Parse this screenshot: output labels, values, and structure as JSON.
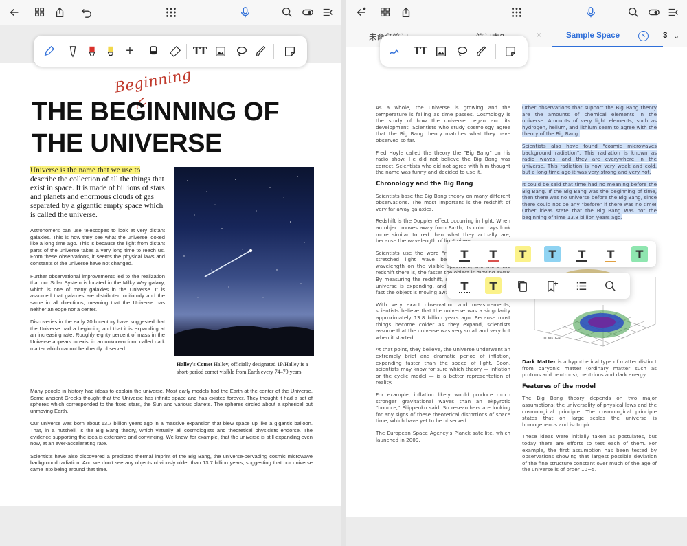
{
  "left": {
    "toolbar": {
      "icons": [
        "back-arrow-icon",
        "grid-view-icon",
        "export-icon",
        "undo-icon",
        "apps-icon",
        "microphone-icon",
        "search-icon",
        "toggle-icon",
        "menu-collapse-icon"
      ]
    },
    "pen_toolbar": {
      "tools": [
        "pen-icon",
        "fountain-pen-icon",
        "red-marker-icon",
        "yellow-highlighter-icon",
        "add-icon",
        "eraser-icon",
        "ruler-icon",
        "text-tool-icon",
        "image-icon",
        "lasso-icon",
        "brush-icon",
        "sticky-note-icon"
      ],
      "plus": "+",
      "text_tool": "TT"
    },
    "document": {
      "handwriting": "Beginning",
      "title_line1": "THE BEGINNING OF",
      "title_line2": "THE UNIVERSE",
      "lead_highlight": "Universe is the name that we use to",
      "lead_rest": "describe the collection of all the things that exist in space. It is made of billions of stars and planets and enormous clouds of gas separated by a gigantic empty space which is called the universe.",
      "col_left": [
        "Astronomers can use telescopes to look at very distant galaxies. This is how they see what the universe looked like a long time ago. This is because the light from distant parts of the universe takes a very long time to reach us. From these observations, it seems the physical laws and constants of the universe have not changed.",
        "Further observational improvements led to the realization that our Solar System is located in the Milky Way galaxy, which is one of many galaxies in the Universe. It is assumed that galaxies are distributed uniformly and the same in all directions, meaning that the Universe has neither an edge nor a center.",
        "Discoveries in the early 20th century have suggested that the Universe had a beginning and that it is expanding at an increasing rate. Roughly eighty percent of mass in the Universe appears to exist in an unknown form called dark matter which cannot be directly observed."
      ],
      "caption_bold": "Halley's Comet",
      "caption_text": "Halley, officially designated 1P/Halley is a short-period comet visible from Earth every 74–79 years.",
      "full_width": [
        "Many people in history had ideas to explain the universe. Most early models had the Earth at the center of the Universe. Some ancient Greeks thought that the Universe has infinite space and has existed forever. They thought it had a set of spheres which corresponded to the fixed stars, the Sun and various planets. The spheres circled about a spherical but unmoving Earth.",
        "Our universe was born about 13.7 billion years ago in a massive expansion that blew space up like a gigantic balloon. That, in a nutshell, is the Big Bang theory, which virtually all cosmologists and theoretical physicists endorse. The evidence supporting the idea is extensive and convincing. We know, for example, that the universe is still expanding even now, at an ever-accelerating rate.",
        "Scientists have also discovered a predicted thermal imprint of the Big Bang, the universe-pervading cosmic microwave background radiation. And we don't see any objects obviously older than 13.7 billion years, suggesting that our universe came into being around that time."
      ]
    }
  },
  "right": {
    "toolbar": {
      "icons": [
        "back-arrow-icon",
        "grid-view-icon",
        "export-icon",
        "apps-icon",
        "microphone-icon",
        "search-icon",
        "toggle-icon",
        "menu-collapse-icon"
      ]
    },
    "tabs": [
      {
        "label": "未命名笔记"
      },
      {
        "label": "笔记本2"
      },
      {
        "label": "Sample Space"
      }
    ],
    "tab_count": "3",
    "pen_toolbar": {
      "tools": [
        "pen-icon",
        "text-tool-icon",
        "image-icon",
        "lasso-icon",
        "brush-icon",
        "sticky-note-icon"
      ],
      "text_tool": "TT"
    },
    "col_left": {
      "paras_top": [
        "As a whole, the universe is growing and the temperature is falling as time passes. Cosmology is the study of how the universe began and its development. Scientists who study cosmology agree that the Big Bang theory matches what they have observed so far.",
        "Fred Hoyle called the theory the \"Big Bang\" on his radio show. He did not believe the Big Bang was correct. Scientists who did not agree with him thought the name was funny and decided to use it."
      ],
      "heading": "Chronology and the Big Bang",
      "paras_bottom": [
        "Scientists base the Big Bang theory on many different observations. The most important is the redshift of very far away galaxies.",
        "Redshift is the Doppler effect occurring in light. When an object moves away from Earth, its color rays look more similar to red than what they actually are, because the wavelength of light given",
        "Scientists use the word \"redshift\" to describe this stretched light wave because the longer the wavelength on the visible spectrum, the more the redshift there is, the faster the object is moving away. By measuring the redshift, scientists proved that the universe is expanding, and they can work out how fast the object is moving away from the Earth.",
        "With very exact observation and measurements, scientists believe that the universe was a singularity approximately 13.8 billion years ago. Because most things become colder as they expand, scientists assume that the universe was very small and very hot when it started.",
        "At that point, they believe, the universe underwent an extremely brief and dramatic period of inflation, expanding faster than the speed of light. Soon, scientists may know for sure which theory — inflation or the cyclic model — is a better representation of reality.",
        "For example, inflation likely would produce much stronger gravitational waves than an ekpyrotic \"bounce,\" Filippenko said. So researchers are looking for any signs of these theoretical distortions of space time, which have yet to be observed.",
        "The European Space Agency's Planck satellite, which launched in 2009."
      ]
    },
    "col_right": {
      "highlighted": [
        "Other observations that support the Big Bang theory are the amounts of chemical elements in the universe. Amounts of very light elements, such as hydrogen, helium, and lithium seem to agree with the theory of the Big Bang.",
        "Scientists also have found \"cosmic microwaves background radiation\". This radiation is known as radio waves, and they are everywhere in the universe. This radiation is now very weak and cold, but a long time ago it was very strong and very hot.",
        "It could be said that time had no meaning before the Big Bang. If the Big Bang was the beginning of time, then there was no universe before the Big Bang, since there could not be any \"before\" if there was no time! Other ideas state that the Big Bang was not the beginning of time 13.8 billion years ago."
      ],
      "axis_label": "T = MK  Gal",
      "dark_matter_bold": "Dark Matter",
      "dark_matter_text": "is a hypothetical type of matter distinct from baryonic matter (ordinary matter such as protons and neutrons), neutrinos and dark energy.",
      "heading": "Features of the model",
      "paras": [
        "The Big Bang theory depends on two major assumptions: the universality of physical laws and the cosmological principle. The cosmological principle states that on large scales the universe is homogeneous and isotropic.",
        "These ideas were initially taken as postulates, but today there are efforts to test each of them. For example, the first assumption has been tested by observations showing that largest possible deviation of the fine structure constant over much of the age of the universe is of order 10−5."
      ]
    },
    "format_popup": {
      "row1": [
        {
          "glyph": "T",
          "style": "underline-black"
        },
        {
          "glyph": "T",
          "style": "underline-red"
        },
        {
          "glyph": "T",
          "style": "highlight-yellow"
        },
        {
          "glyph": "T",
          "style": "highlight-blue"
        },
        {
          "glyph": "T",
          "style": "strike"
        },
        {
          "glyph": "T",
          "style": "underline-squiggle"
        },
        {
          "glyph": "T",
          "style": "highlight-green"
        }
      ],
      "row2_text": [
        {
          "glyph": "T",
          "style": "underline-dotted"
        },
        {
          "glyph": "T",
          "style": "highlight-yellow"
        }
      ],
      "row2_icons": [
        "copy-icon",
        "bookmark-add-icon",
        "list-add-icon",
        "search-icon"
      ],
      "colors": {
        "yellow": "#fbf28a",
        "blue": "#8fd3f2",
        "green": "#8fe6b0",
        "red": "#d9534f"
      }
    }
  },
  "colors": {
    "accent_blue": "#2f6fd9",
    "highlight_blue": "#cfe0f7",
    "highlight_yellow": "#fbf27a"
  }
}
